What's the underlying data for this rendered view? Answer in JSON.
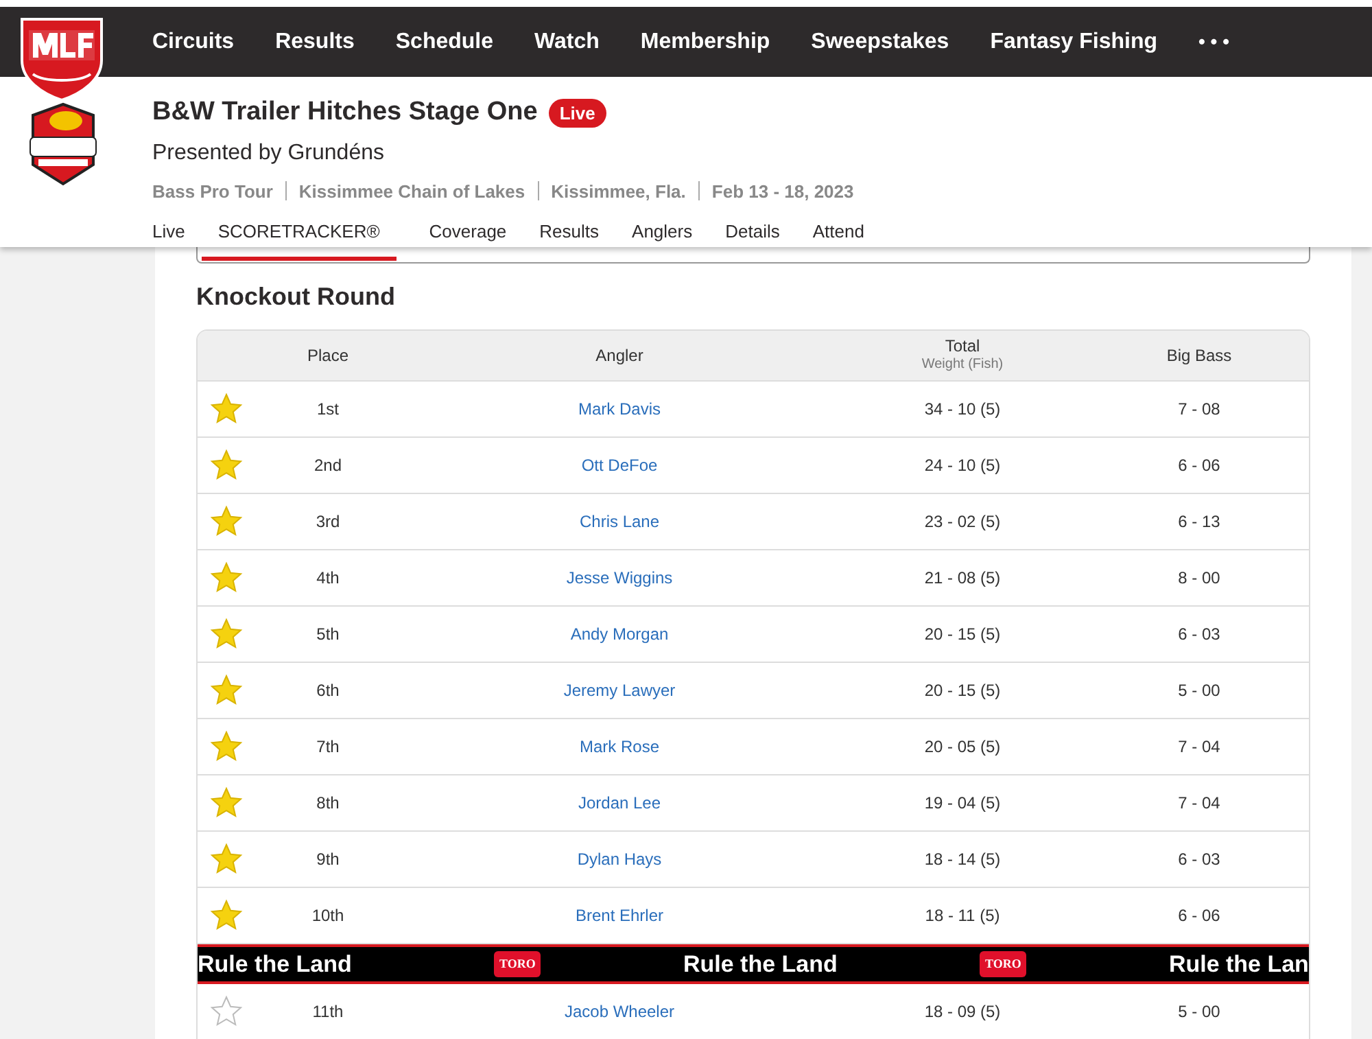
{
  "nav": {
    "items": [
      "Circuits",
      "Results",
      "Schedule",
      "Watch",
      "Membership",
      "Sweepstakes",
      "Fantasy Fishing"
    ],
    "more": "• • •"
  },
  "event": {
    "title": "B&W Trailer Hitches Stage One",
    "badge": "Live",
    "presenter": "Presented by Grundéns",
    "meta": [
      "Bass Pro Tour",
      "Kissimmee Chain of Lakes",
      "Kissimmee, Fla.",
      "Feb 13 - 18, 2023"
    ]
  },
  "tabs": [
    {
      "label": "Live",
      "selected": false
    },
    {
      "label": "SCORETRACKER®",
      "selected": true
    },
    {
      "label": "Coverage",
      "selected": false
    },
    {
      "label": "Results",
      "selected": false
    },
    {
      "label": "Anglers",
      "selected": false
    },
    {
      "label": "Details",
      "selected": false
    },
    {
      "label": "Attend",
      "selected": false
    }
  ],
  "section_title": "Knockout Round",
  "table": {
    "columns": [
      {
        "label": "Place"
      },
      {
        "label": "Angler"
      },
      {
        "label": "Total",
        "sub": "Weight (Fish)"
      },
      {
        "label": "Big Bass"
      }
    ],
    "rows": [
      {
        "kind": "row",
        "starred": true,
        "place": "1st",
        "angler": "Mark Davis",
        "total": "34 - 10 (5)",
        "big_bass": "7 - 08"
      },
      {
        "kind": "row",
        "starred": true,
        "place": "2nd",
        "angler": "Ott DeFoe",
        "total": "24 - 10 (5)",
        "big_bass": "6 - 06"
      },
      {
        "kind": "row",
        "starred": true,
        "place": "3rd",
        "angler": "Chris Lane",
        "total": "23 - 02 (5)",
        "big_bass": "6 - 13"
      },
      {
        "kind": "row",
        "starred": true,
        "place": "4th",
        "angler": "Jesse Wiggins",
        "total": "21 - 08 (5)",
        "big_bass": "8 - 00"
      },
      {
        "kind": "row",
        "starred": true,
        "place": "5th",
        "angler": "Andy Morgan",
        "total": "20 - 15 (5)",
        "big_bass": "6 - 03"
      },
      {
        "kind": "row",
        "starred": true,
        "place": "6th",
        "angler": "Jeremy Lawyer",
        "total": "20 - 15 (5)",
        "big_bass": "5 - 00"
      },
      {
        "kind": "row",
        "starred": true,
        "place": "7th",
        "angler": "Mark Rose",
        "total": "20 - 05 (5)",
        "big_bass": "7 - 04"
      },
      {
        "kind": "row",
        "starred": true,
        "place": "8th",
        "angler": "Jordan Lee",
        "total": "19 - 04 (5)",
        "big_bass": "7 - 04"
      },
      {
        "kind": "row",
        "starred": true,
        "place": "9th",
        "angler": "Dylan Hays",
        "total": "18 - 14 (5)",
        "big_bass": "6 - 03"
      },
      {
        "kind": "row",
        "starred": true,
        "place": "10th",
        "angler": "Brent Ehrler",
        "total": "18 - 11 (5)",
        "big_bass": "6 - 06"
      },
      {
        "kind": "banner",
        "items": [
          {
            "kind": "text",
            "text": "Rule the Land"
          },
          {
            "kind": "logo",
            "text": "TORO"
          },
          {
            "kind": "text",
            "text": "Rule the Land"
          },
          {
            "kind": "logo",
            "text": "TORO"
          },
          {
            "kind": "text",
            "text": "Rule the Lan"
          }
        ]
      },
      {
        "kind": "row",
        "starred": false,
        "place": "11th",
        "angler": "Jacob Wheeler",
        "total": "18 - 09 (5)",
        "big_bass": "5 - 00"
      }
    ]
  }
}
